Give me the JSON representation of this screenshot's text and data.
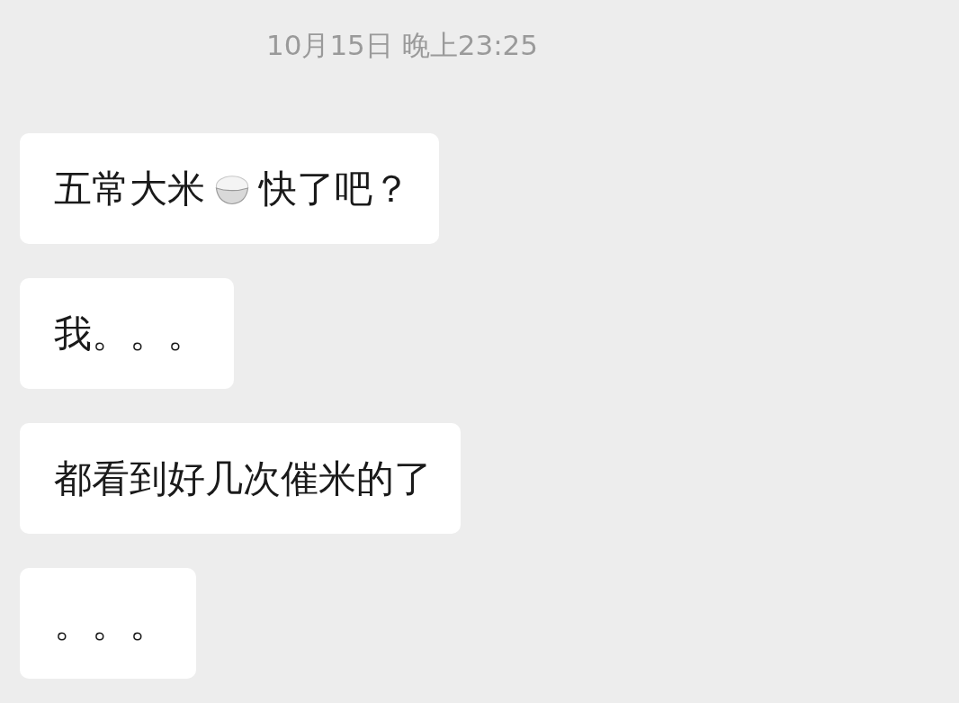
{
  "timestamp": "10月15日 晚上23:25",
  "messages": [
    {
      "parts": [
        {
          "kind": "text",
          "text": "五常大米"
        },
        {
          "kind": "icon"
        },
        {
          "kind": "text",
          "text": "快了吧？"
        }
      ]
    },
    {
      "parts": [
        {
          "kind": "text",
          "text": "我。。。"
        }
      ]
    },
    {
      "parts": [
        {
          "kind": "text",
          "text": "都看到好几次催米的了"
        }
      ]
    },
    {
      "parts": [
        {
          "kind": "text",
          "text": "。。。"
        }
      ]
    }
  ]
}
